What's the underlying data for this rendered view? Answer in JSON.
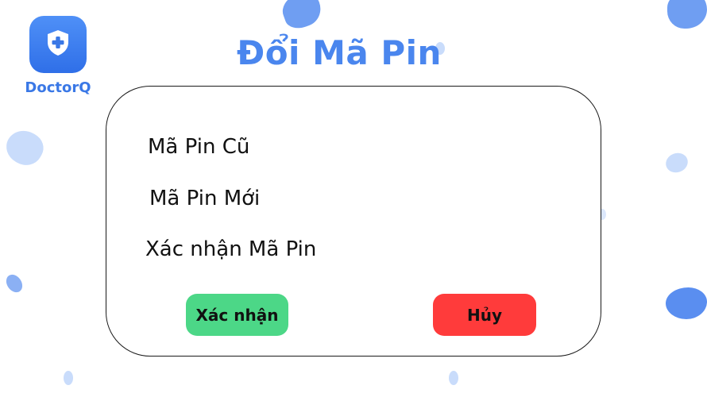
{
  "app": {
    "logo_text": "DoctorQ",
    "logo_icon": "shield-plus-icon",
    "brand_color": "#3a78e6"
  },
  "page": {
    "title": "Đổi Mã Pin"
  },
  "form": {
    "old_pin_label": "Mã Pin Cũ",
    "new_pin_label": "Mã Pin Mới",
    "confirm_pin_label": "Xác nhận Mã Pin"
  },
  "actions": {
    "confirm_label": "Xác nhận",
    "confirm_color": "#4cd787",
    "cancel_label": "Hủy",
    "cancel_color": "#ff3b3b"
  }
}
